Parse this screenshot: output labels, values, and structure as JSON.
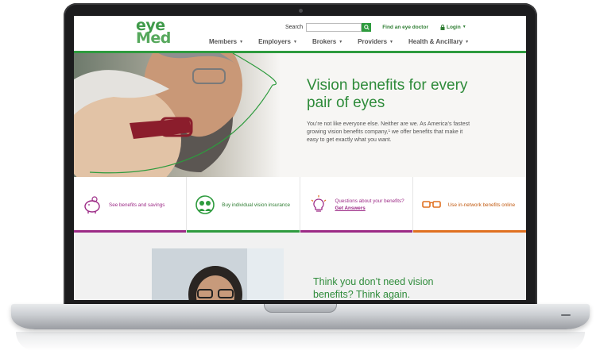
{
  "header": {
    "logo_top": "eye",
    "logo_bottom": "Med",
    "search_label": "Search",
    "search_placeholder": "",
    "find_doctor": "Find an eye doctor",
    "login": "Login"
  },
  "nav": [
    {
      "label": "Members"
    },
    {
      "label": "Employers"
    },
    {
      "label": "Brokers"
    },
    {
      "label": "Providers"
    },
    {
      "label": "Health & Ancillary"
    }
  ],
  "hero": {
    "title": "Vision benefits for every pair of eyes",
    "body": "You’re not like everyone else. Neither are we. As America’s fastest growing vision benefits company,¹ we offer benefits that make it easy to get exactly what you want."
  },
  "features": [
    {
      "label": "See benefits and savings",
      "icon": "piggy-bank-icon",
      "color": "#9c2a86"
    },
    {
      "label": "Buy individual vision insurance",
      "icon": "people-icon",
      "color": "#2e9b3e"
    },
    {
      "label": "Questions about your benefits?",
      "link": "Get Answers",
      "icon": "lightbulb-icon",
      "color": "#9c2a86"
    },
    {
      "label": "Use in-network benefits online",
      "icon": "glasses-icon",
      "color": "#e07020"
    }
  ],
  "lower": {
    "title": "Think you don’t need vision benefits? Think again."
  },
  "colors": {
    "brand_green": "#2e9b3e",
    "purple": "#9c2a86",
    "orange": "#e07020"
  }
}
